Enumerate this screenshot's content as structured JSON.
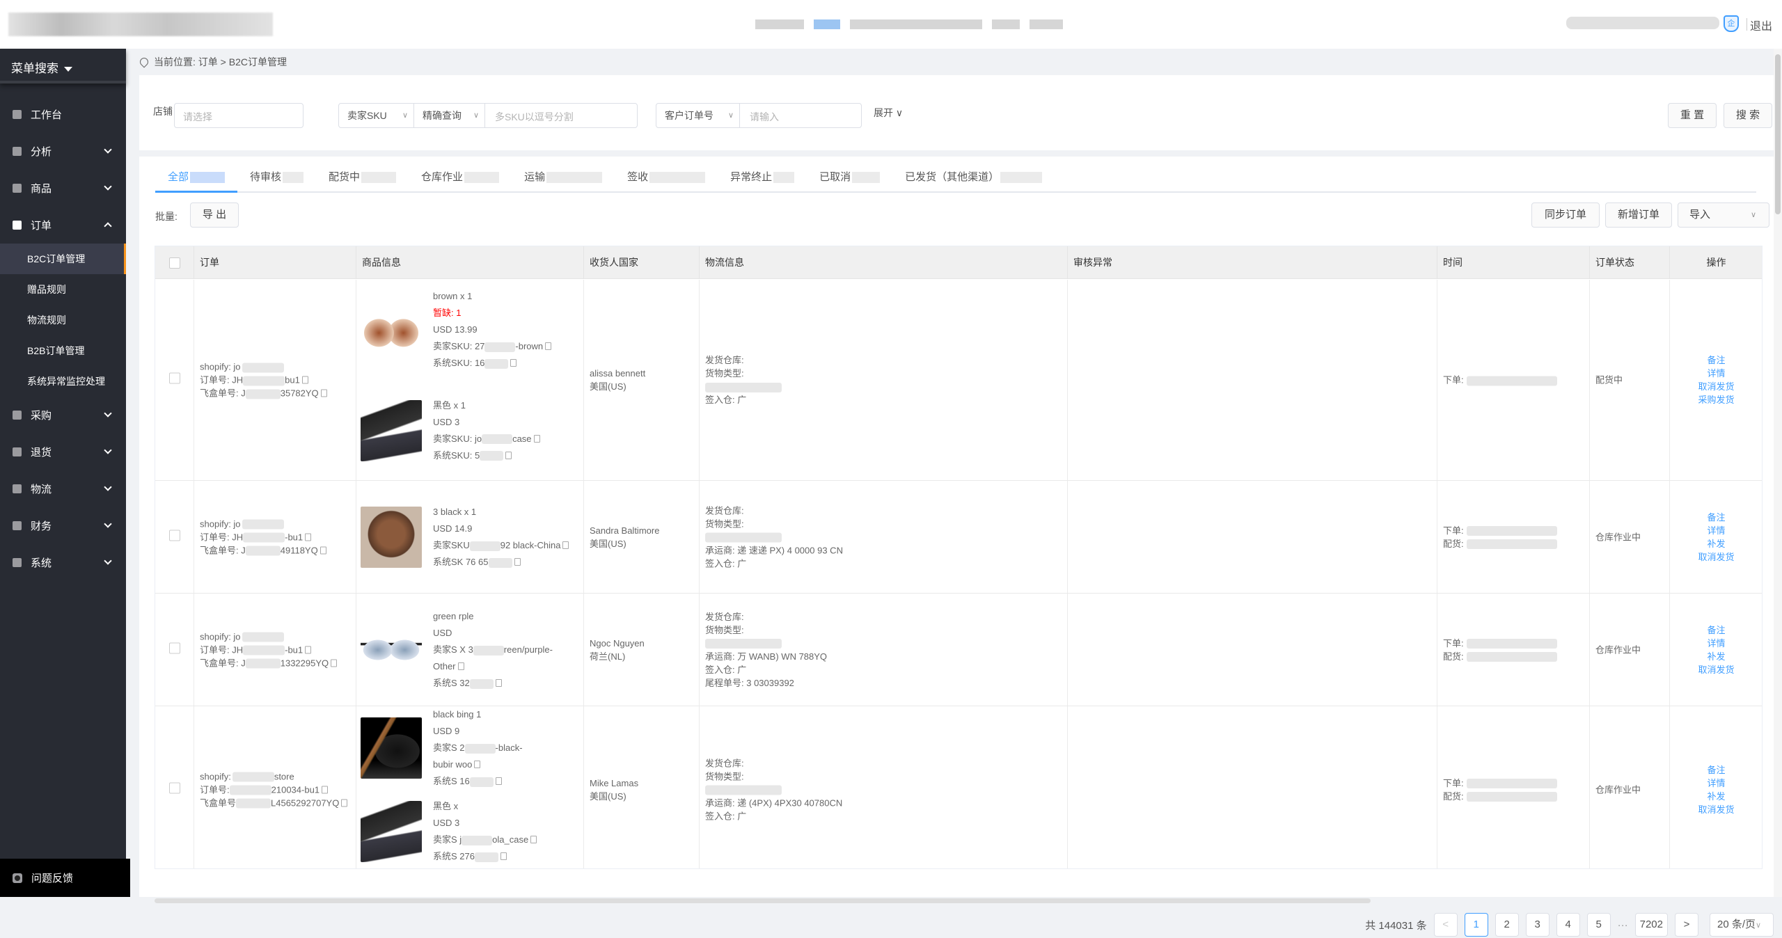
{
  "header": {
    "logout_label": "退出",
    "enterprise_icon": "企"
  },
  "sidebar": {
    "search_label": "菜单搜索",
    "items": [
      {
        "label": "工作台",
        "icon": "home-icon",
        "expandable": false
      },
      {
        "label": "分析",
        "icon": "chart-icon",
        "expandable": true
      },
      {
        "label": "商品",
        "icon": "goods-icon",
        "expandable": true
      },
      {
        "label": "订单",
        "icon": "order-icon",
        "expandable": true,
        "open": true
      },
      {
        "label": "采购",
        "icon": "purchase-icon",
        "expandable": true
      },
      {
        "label": "退货",
        "icon": "return-icon",
        "expandable": true
      },
      {
        "label": "物流",
        "icon": "logistics-icon",
        "expandable": true
      },
      {
        "label": "财务",
        "icon": "finance-icon",
        "expandable": true
      },
      {
        "label": "系统",
        "icon": "system-icon",
        "expandable": true
      }
    ],
    "order_sub": [
      "B2C订单管理",
      "赠品规则",
      "物流规则",
      "B2B订单管理",
      "系统异常监控处理"
    ],
    "active_sub": "B2C订单管理",
    "feedback_label": "问题反馈"
  },
  "breadcrumb": {
    "prefix": "当前位置:",
    "path": [
      "订单",
      "B2C订单管理"
    ],
    "separator": ">"
  },
  "filter": {
    "store_label": "店铺",
    "store_placeholder": "请选择",
    "sku_type": "卖家SKU",
    "match_type": "精确查询",
    "sku_placeholder": "多SKU以逗号分割",
    "order_type": "客户订单号",
    "order_placeholder": "请输入",
    "expand_label": "展开",
    "reset_label": "重 置",
    "search_label": "搜 索"
  },
  "tabs": [
    {
      "label": "全部",
      "active": true
    },
    {
      "label": "待审核"
    },
    {
      "label": "配货中"
    },
    {
      "label": "仓库作业"
    },
    {
      "label": "运输"
    },
    {
      "label": "签收"
    },
    {
      "label": "异常终止"
    },
    {
      "label": "已取消"
    },
    {
      "label": "已发货（其他渠道）"
    }
  ],
  "toolbar": {
    "batch_label": "批量:",
    "export_label": "导 出",
    "sync_label": "同步订单",
    "add_label": "新增订单",
    "import_label": "导入"
  },
  "table": {
    "columns": [
      "订单",
      "商品信息",
      "收货人国家",
      "物流信息",
      "审核异常",
      "时间",
      "订单状态",
      "操作"
    ],
    "rows": [
      {
        "platform": "shopify: jo",
        "order_no": "订单号: JH",
        "order_suffix": "bu1",
        "fh_no": "飞盒单号: J",
        "fh_suffix": "35782YQ",
        "products": [
          {
            "title": "brown x 1",
            "shortage": "暂缺: 1",
            "price": "USD 13.99",
            "seller_sku": "卖家SKU:  27",
            "seller_sku_suffix": "-brown",
            "sys_sku": "系统SKU: 16",
            "image": "sunglasses-brown"
          },
          {
            "title": "黑色 x 1",
            "price": "USD 3",
            "seller_sku": "卖家SKU:  jo",
            "seller_sku_suffix": "case",
            "sys_sku": "系统SKU: 5",
            "image": "glasses-case"
          }
        ],
        "receiver": "alissa bennett",
        "country": "美国(US)",
        "logistics": [
          "发货仓库:",
          "货物类型:",
          "",
          "签入仓: 广"
        ],
        "time": [
          "下单:"
        ],
        "status": "配货中",
        "ops": [
          "备注",
          "详情",
          "取消发货",
          "采购发货"
        ]
      },
      {
        "platform": "shopify: jo",
        "order_no": "订单号: JH",
        "order_suffix": "-bu1",
        "fh_no": "飞盒单号: J",
        "fh_suffix": "49118YQ",
        "products": [
          {
            "title": "3 black x 1",
            "price": "USD 14.9",
            "seller_sku": "卖家SKU",
            "seller_sku_suffix": "92  black-China",
            "sys_sku": "系统SK  76  65",
            "image": "model-photo"
          }
        ],
        "receiver": "Sandra Baltimore",
        "country": "美国(US)",
        "logistics": [
          "发货仓库:",
          "货物类型:",
          "",
          "承运商: 递  速递  PX)  4   0000   93   CN",
          "签入仓: 广"
        ],
        "time": [
          "下单:",
          "配货:"
        ],
        "status": "仓库作业中",
        "ops": [
          "备注",
          "详情",
          "补发",
          "取消发货"
        ]
      },
      {
        "platform": "shopify: jo",
        "order_no": "订单号: JH",
        "order_suffix": "-bu1",
        "fh_no": "飞盒单号: J",
        "fh_suffix": "1332295YQ",
        "products": [
          {
            "title": "green  rple",
            "price": "USD",
            "seller_sku": "卖家S   X   3",
            "seller_sku_suffix": "reen/purple-",
            "seller_sku_line2": "Other",
            "sys_sku": "系统S   32",
            "image": "sunglasses-gradient"
          }
        ],
        "receiver": "Ngoc Nguyen",
        "country": "荷兰(NL)",
        "logistics": [
          "发货仓库:",
          "货物类型:",
          "",
          "承运商: 万   WANB)  WN   788YQ",
          "签入仓: 广",
          "尾程单号: 3   03039392"
        ],
        "time": [
          "下单:",
          "配货:"
        ],
        "status": "仓库作业中",
        "ops": [
          "备注",
          "详情",
          "补发",
          "取消发货"
        ]
      },
      {
        "platform": "shopify:",
        "platform_suffix": "store",
        "order_no": "订单号:",
        "order_suffix": "210034-bu1",
        "fh_no": "飞盒单号",
        "fh_suffix": "L4565292707YQ",
        "products": [
          {
            "title": "black  bing  1",
            "price": "USD  9",
            "seller_sku": "卖家S   2",
            "seller_sku_suffix": "-black-",
            "seller_sku_line2": "bubir  woo",
            "sys_sku": "系统S  16",
            "image": "sunglasses-wood"
          },
          {
            "title": "黑色 x",
            "price": "USD 3",
            "seller_sku": "卖家S   j",
            "seller_sku_suffix": "ola_case",
            "sys_sku": "系统S   276",
            "image": "glasses-case"
          }
        ],
        "receiver": "Mike Lamas",
        "country": "美国(US)",
        "logistics": [
          "发货仓库:",
          "货物类型:",
          "",
          "承运商: 递  (4PX)  4PX30   40780CN",
          "签入仓: 广"
        ],
        "time": [
          "下单:",
          "配货:"
        ],
        "status": "仓库作业中",
        "ops": [
          "备注",
          "详情",
          "补发",
          "取消发货"
        ]
      }
    ]
  },
  "pagination": {
    "total_label": "共 144031 条",
    "pages": [
      "1",
      "2",
      "3",
      "4",
      "5"
    ],
    "ellipsis": "···",
    "last_page": "7202",
    "current": "1",
    "page_size": "20 条/页"
  },
  "colors": {
    "accent": "#409eff",
    "sidebar_bg": "#282b33",
    "active_marker": "#f7941d",
    "shortage": "#ff0000"
  }
}
